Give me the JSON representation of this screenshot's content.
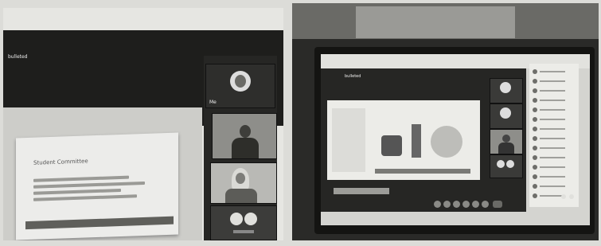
{
  "left_screen": {
    "app_title": "bulleted",
    "presenter_label": "Me",
    "slide_title": "Student Committee",
    "participants": [
      {
        "kind": "avatar-initial"
      },
      {
        "kind": "camera-male"
      },
      {
        "kind": "camera-female-hijab"
      },
      {
        "kind": "two-avatars"
      }
    ]
  },
  "right_screen": {
    "app_title": "bulleted",
    "participant_list_count": 14,
    "control_buttons": 7
  },
  "colors": {
    "left_bg": "#e6e6e2",
    "meeting_dark": "#1e1e1c",
    "tile_dark": "#3a3a38",
    "slide_bg": "#ececea",
    "slide_bar": "#5f5f5b",
    "right_bg": "#2a2a28"
  }
}
